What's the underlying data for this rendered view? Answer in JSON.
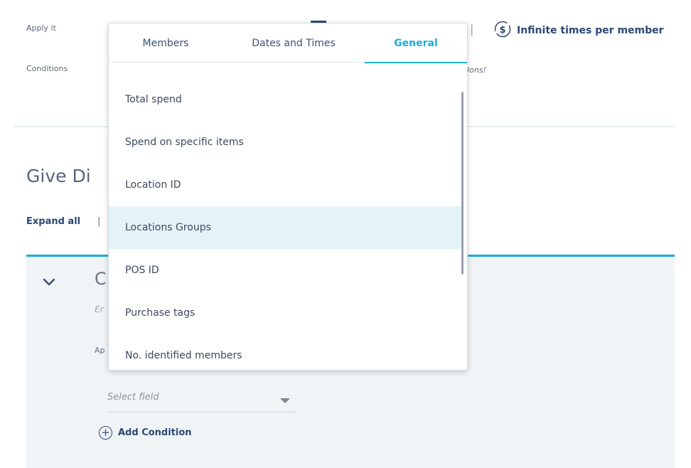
{
  "top": {
    "apply_it_label": "Apply it",
    "conditions_label": "Conditions",
    "infinite_label": "Infinite times per member",
    "pipe": "|",
    "italic_fragment": "ions!"
  },
  "section": {
    "title_fragment": "Give Di",
    "expand_all": "Expand all",
    "pipe": "|"
  },
  "panel": {
    "title_fragment": "C",
    "sub_fragment": "Er",
    "apply_fragment": "Ap",
    "select_placeholder": "Select field",
    "add_condition": "Add Condition"
  },
  "dropdown": {
    "tabs": [
      "Members",
      "Dates and Times",
      "General"
    ],
    "active_tab": "General",
    "items": [
      "Total spend",
      "Spend on specific items",
      "Location ID",
      "Locations Groups",
      "POS ID",
      "Purchase tags",
      "No. identified members"
    ],
    "highlighted_item": "Locations Groups"
  },
  "colors": {
    "accent": "#1aaedb",
    "navy": "#2d4873",
    "highlight": "#e4f3f8",
    "panel_bg": "#f0f4f6"
  }
}
